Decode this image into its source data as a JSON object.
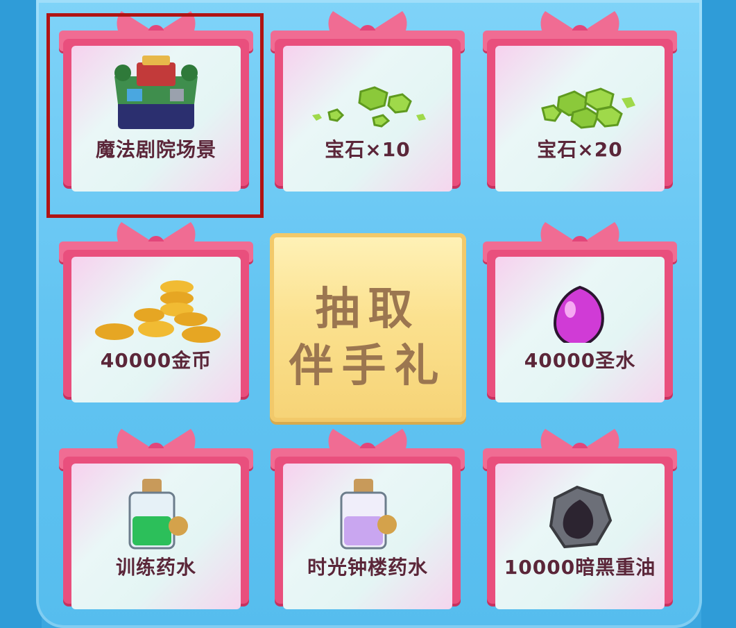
{
  "draw_button": {
    "line1": "抽取",
    "line2": "伴手礼"
  },
  "prizes": [
    {
      "label": "魔法剧院场景",
      "icon": "magic-theater-icon",
      "selected": true
    },
    {
      "label": "宝石×10",
      "icon": "gems-small-icon"
    },
    {
      "label": "宝石×20",
      "icon": "gems-large-icon"
    },
    {
      "label": "40000金币",
      "icon": "gold-coins-icon"
    },
    {
      "label": "40000圣水",
      "icon": "elixir-drop-icon"
    },
    {
      "label": "训练药水",
      "icon": "training-potion-icon"
    },
    {
      "label": "时光钟楼药水",
      "icon": "clock-tower-potion-icon"
    },
    {
      "label": "10000暗黑重油",
      "icon": "dark-elixir-icon"
    }
  ],
  "colors": {
    "gift_red": "#e94f7d",
    "button_gold": "#fbe18f",
    "label": "#5b2639",
    "selection": "#b01414"
  }
}
